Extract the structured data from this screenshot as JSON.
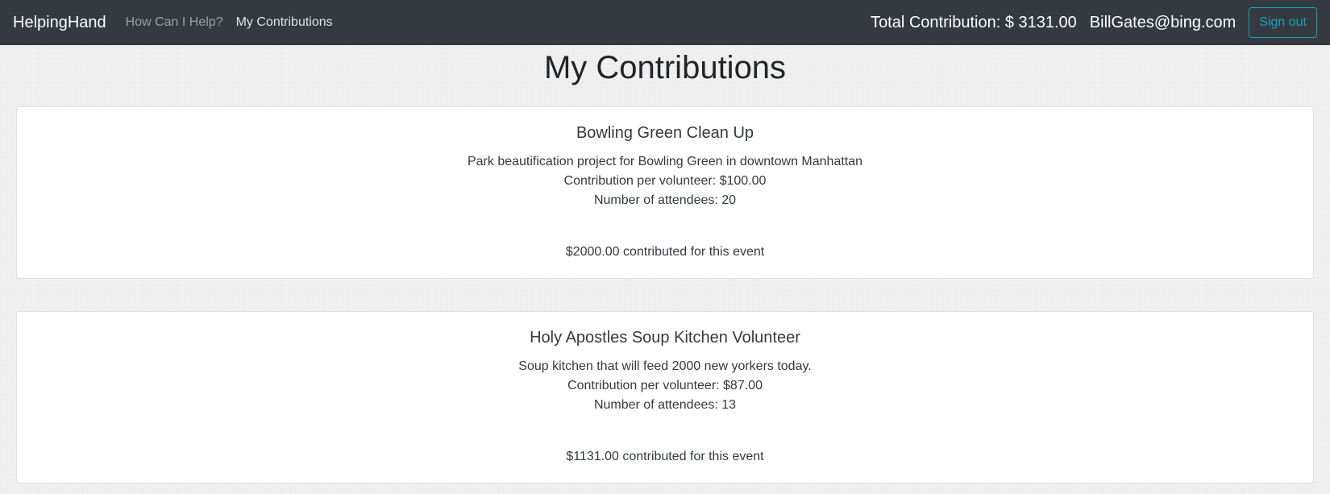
{
  "nav": {
    "brand": "HelpingHand",
    "links": [
      "How Can I Help?",
      "My Contributions"
    ],
    "total": "Total Contribution: $ 3131.00",
    "email": "BillGates@bing.com",
    "signout": "Sign out"
  },
  "page": {
    "title": "My Contributions"
  },
  "events": [
    {
      "title": "Bowling Green Clean Up",
      "description": "Park beautification project for Bowling Green in downtown Manhattan",
      "per_volunteer": "Contribution per volunteer: $100.00",
      "attendees": "Number of attendees: 20",
      "total": "$2000.00 contributed for this event"
    },
    {
      "title": "Holy Apostles Soup Kitchen Volunteer",
      "description": "Soup kitchen that will feed 2000 new yorkers today.",
      "per_volunteer": "Contribution per volunteer: $87.00",
      "attendees": "Number of attendees: 13",
      "total": "$1131.00 contributed for this event"
    }
  ],
  "colors": {
    "navbar": "#343a40",
    "accent": "#17a2b8"
  }
}
